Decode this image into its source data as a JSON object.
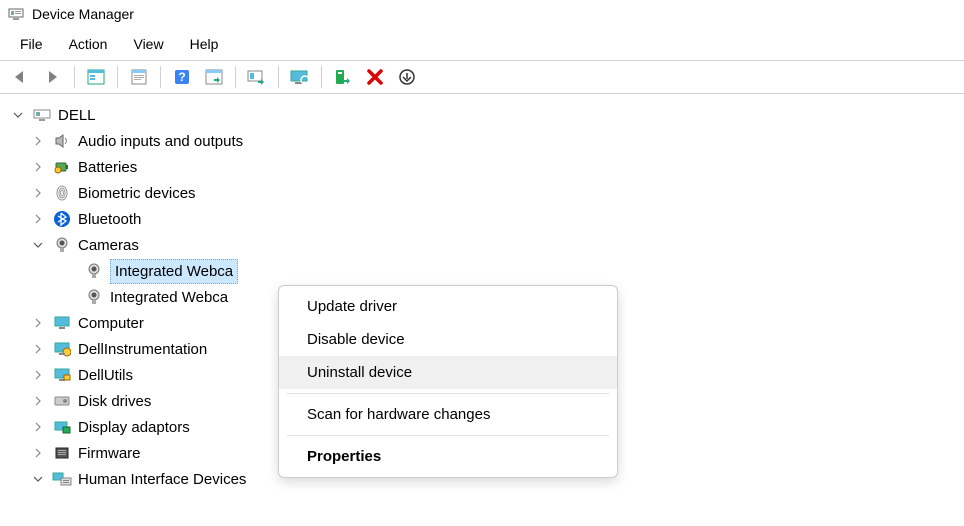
{
  "window": {
    "title": "Device Manager"
  },
  "menu": {
    "file": "File",
    "action": "Action",
    "view": "View",
    "help": "Help"
  },
  "toolbar": {
    "back": "back",
    "forward": "forward",
    "show_hide": "show-hide-console-tree",
    "properties": "properties",
    "help": "help",
    "action_list": "action-list",
    "update": "update-driver",
    "scan": "scan-hardware",
    "add_legacy": "add-legacy-hardware",
    "uninstall": "uninstall",
    "more": "view-options"
  },
  "tree": {
    "root": "DELL",
    "nodes": [
      {
        "label": "Audio inputs and outputs",
        "expanded": false,
        "icon": "speaker"
      },
      {
        "label": "Batteries",
        "expanded": false,
        "icon": "battery"
      },
      {
        "label": "Biometric devices",
        "expanded": false,
        "icon": "fingerprint"
      },
      {
        "label": "Bluetooth",
        "expanded": false,
        "icon": "bluetooth"
      },
      {
        "label": "Cameras",
        "expanded": true,
        "icon": "camera",
        "children": [
          {
            "label": "Integrated Webca",
            "icon": "camera",
            "selected": true
          },
          {
            "label": "Integrated Webca",
            "icon": "camera",
            "selected": false
          }
        ]
      },
      {
        "label": "Computer",
        "expanded": false,
        "icon": "monitor"
      },
      {
        "label": "DellInstrumentation",
        "expanded": false,
        "icon": "dell-instr"
      },
      {
        "label": "DellUtils",
        "expanded": false,
        "icon": "dell-utils"
      },
      {
        "label": "Disk drives",
        "expanded": false,
        "icon": "disk"
      },
      {
        "label": "Display adaptors",
        "expanded": false,
        "icon": "display"
      },
      {
        "label": "Firmware",
        "expanded": false,
        "icon": "firmware"
      },
      {
        "label": "Human Interface Devices",
        "expanded": true,
        "icon": "hid"
      }
    ]
  },
  "context_menu": {
    "update": "Update driver",
    "disable": "Disable device",
    "uninstall": "Uninstall device",
    "scan": "Scan for hardware changes",
    "properties": "Properties",
    "hovered": "uninstall"
  }
}
